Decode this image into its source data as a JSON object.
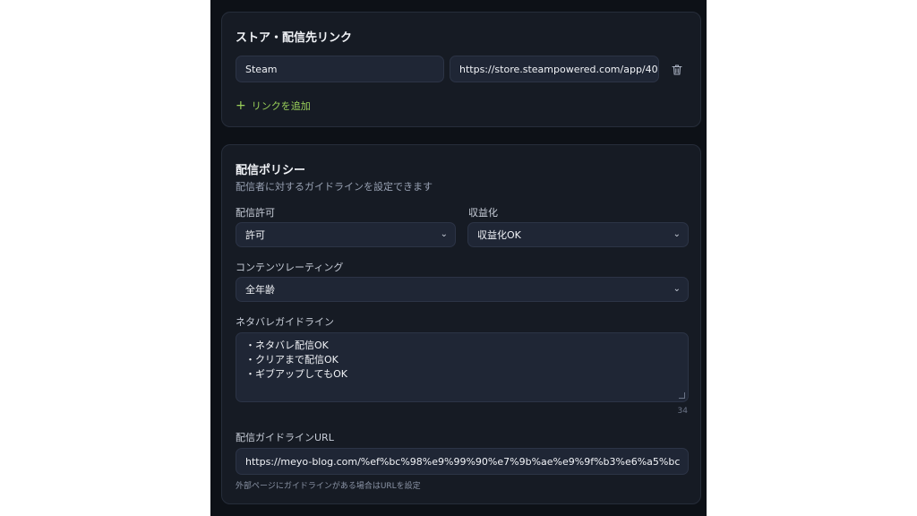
{
  "store": {
    "title": "ストア・配信先リンク",
    "links": [
      {
        "name": "Steam",
        "url": "https://store.steampowered.com/app/40"
      }
    ],
    "add_link_label": "リンクを追加"
  },
  "policy": {
    "title": "配信ポリシー",
    "subtitle": "配信者に対するガイドラインを設定できます",
    "permission": {
      "label": "配信許可",
      "value": "許可"
    },
    "monetization": {
      "label": "収益化",
      "value": "収益化OK"
    },
    "rating": {
      "label": "コンテンツレーティング",
      "value": "全年齢"
    },
    "spoiler": {
      "label": "ネタバレガイドライン",
      "lines": [
        "・ネタバレ配信OK",
        "・クリアまで配信OK",
        "・ギブアップしてもOK"
      ],
      "char_count": "34"
    },
    "guideline_url": {
      "label": "配信ガイドラインURL",
      "value": "https://meyo-blog.com/%ef%bc%98%e9%99%90%e7%9b%ae%e9%9f%b3%e6%a5%bc",
      "hint": "外部ページにガイドラインがある場合はURLを設定"
    }
  },
  "colors": {
    "background": "#0d1117",
    "card": "#161b24",
    "field": "#1f2635",
    "accent_green": "#9bd15a"
  },
  "icons": {
    "delete": "trash-icon",
    "add": "plus-icon",
    "select": "chevron-down-icon"
  }
}
